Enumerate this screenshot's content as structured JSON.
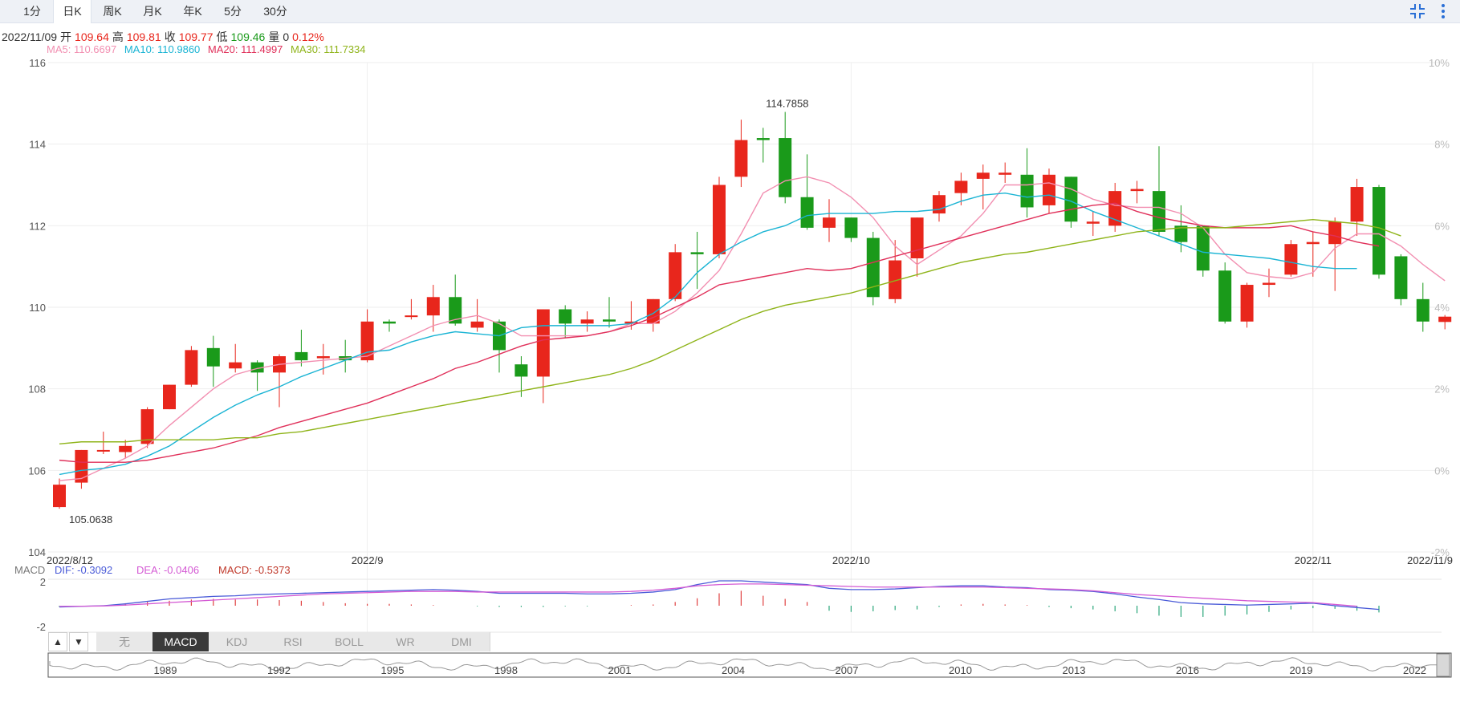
{
  "tabs": [
    {
      "label": "1分"
    },
    {
      "label": "日K"
    },
    {
      "label": "周K"
    },
    {
      "label": "月K"
    },
    {
      "label": "年K"
    },
    {
      "label": "5分"
    },
    {
      "label": "30分"
    }
  ],
  "active_tab": 1,
  "info": {
    "date": "2022/11/09",
    "open_label": "开",
    "open": "109.64",
    "high_label": "高",
    "high": "109.81",
    "close_label": "收",
    "close": "109.77",
    "low_label": "低",
    "low": "109.46",
    "vol_label": "量",
    "vol": "0",
    "change": "0.12%"
  },
  "ma": {
    "ma5": "MA5: 110.6697",
    "ma10": "MA10: 110.9860",
    "ma20": "MA20: 111.4997",
    "ma30": "MA30: 111.7334"
  },
  "macd_legend": {
    "title": "MACD",
    "dif": "DIF: -0.3092",
    "dea": "DEA: -0.0406",
    "macd": "MACD: -0.5373"
  },
  "indicator_tabs": [
    "无",
    "MACD",
    "KDJ",
    "RSI",
    "BOLL",
    "WR",
    "DMI"
  ],
  "active_indicator": 1,
  "up_arrow": "▲",
  "down_arrow": "▼",
  "nav_years": [
    "1989",
    "1992",
    "1995",
    "1998",
    "2001",
    "2004",
    "2007",
    "2010",
    "2013",
    "2016",
    "2019",
    "2022"
  ],
  "colors": {
    "up": "#e8261c",
    "down": "#1a9a1a",
    "ma5": "#f28fb1",
    "ma10": "#1ab4d4",
    "ma20": "#e0305a",
    "ma30": "#8fb41a",
    "dif": "#4a5bd8",
    "dea": "#d45ad4"
  },
  "chart_data": {
    "type": "candlestick",
    "title": "",
    "ylim": [
      104,
      116
    ],
    "yticks": [
      "116",
      "114",
      "112",
      "110",
      "108",
      "106",
      "104"
    ],
    "right_ticks": [
      "10%",
      "8%",
      "6%",
      "4%",
      "2%",
      "0%",
      "-2%"
    ],
    "x_labels": [
      {
        "label": "2022/8/12",
        "i": 0
      },
      {
        "label": "2022/9",
        "i": 14
      },
      {
        "label": "2022/10",
        "i": 36
      },
      {
        "label": "2022/11",
        "i": 57
      },
      {
        "label": "2022/11/9",
        "i": 63
      }
    ],
    "max_label": "114.7858",
    "min_label": "105.0638",
    "candles": [
      {
        "o": 105.1,
        "c": 105.65,
        "h": 105.8,
        "l": 105.06
      },
      {
        "o": 105.7,
        "c": 106.5,
        "h": 106.5,
        "l": 105.55
      },
      {
        "o": 106.5,
        "c": 106.5,
        "h": 106.95,
        "l": 106.4
      },
      {
        "o": 106.45,
        "c": 106.6,
        "h": 106.75,
        "l": 106.3
      },
      {
        "o": 106.65,
        "c": 107.5,
        "h": 107.55,
        "l": 106.55
      },
      {
        "o": 107.5,
        "c": 108.1,
        "h": 108.1,
        "l": 107.5
      },
      {
        "o": 108.1,
        "c": 108.95,
        "h": 109.05,
        "l": 108.05
      },
      {
        "o": 109.0,
        "c": 108.55,
        "h": 109.3,
        "l": 108.05
      },
      {
        "o": 108.5,
        "c": 108.65,
        "h": 109.1,
        "l": 108.4
      },
      {
        "o": 108.65,
        "c": 108.4,
        "h": 108.7,
        "l": 107.95
      },
      {
        "o": 108.4,
        "c": 108.8,
        "h": 108.85,
        "l": 107.55
      },
      {
        "o": 108.9,
        "c": 108.7,
        "h": 109.45,
        "l": 108.55
      },
      {
        "o": 108.75,
        "c": 108.8,
        "h": 109.1,
        "l": 108.35
      },
      {
        "o": 108.8,
        "c": 108.7,
        "h": 109.2,
        "l": 108.4
      },
      {
        "o": 108.7,
        "c": 109.65,
        "h": 109.95,
        "l": 108.65
      },
      {
        "o": 109.65,
        "c": 109.6,
        "h": 109.7,
        "l": 109.4
      },
      {
        "o": 109.78,
        "c": 109.8,
        "h": 110.2,
        "l": 109.7
      },
      {
        "o": 109.8,
        "c": 110.25,
        "h": 110.55,
        "l": 109.4
      },
      {
        "o": 110.25,
        "c": 109.6,
        "h": 110.8,
        "l": 109.55
      },
      {
        "o": 109.5,
        "c": 109.65,
        "h": 110.2,
        "l": 109.4
      },
      {
        "o": 109.65,
        "c": 108.95,
        "h": 109.7,
        "l": 108.4
      },
      {
        "o": 108.6,
        "c": 108.3,
        "h": 108.8,
        "l": 107.8
      },
      {
        "o": 108.3,
        "c": 109.95,
        "h": 109.95,
        "l": 107.65
      },
      {
        "o": 109.95,
        "c": 109.6,
        "h": 110.05,
        "l": 109.25
      },
      {
        "o": 109.6,
        "c": 109.7,
        "h": 109.9,
        "l": 109.4
      },
      {
        "o": 109.7,
        "c": 109.65,
        "h": 110.25,
        "l": 109.5
      },
      {
        "o": 109.6,
        "c": 109.65,
        "h": 110.15,
        "l": 109.45
      },
      {
        "o": 109.6,
        "c": 110.2,
        "h": 110.2,
        "l": 109.4
      },
      {
        "o": 110.2,
        "c": 111.35,
        "h": 111.55,
        "l": 110.15
      },
      {
        "o": 111.35,
        "c": 111.3,
        "h": 111.85,
        "l": 110.45
      },
      {
        "o": 111.3,
        "c": 113.0,
        "h": 113.2,
        "l": 111.2
      },
      {
        "o": 113.2,
        "c": 114.1,
        "h": 114.6,
        "l": 112.95
      },
      {
        "o": 114.15,
        "c": 114.1,
        "h": 114.4,
        "l": 113.55
      },
      {
        "o": 114.15,
        "c": 112.7,
        "h": 114.79,
        "l": 112.55
      },
      {
        "o": 112.7,
        "c": 111.95,
        "h": 113.75,
        "l": 111.9
      },
      {
        "o": 111.95,
        "c": 112.2,
        "h": 112.65,
        "l": 111.6
      },
      {
        "o": 112.2,
        "c": 111.7,
        "h": 112.2,
        "l": 111.6
      },
      {
        "o": 111.7,
        "c": 110.25,
        "h": 111.85,
        "l": 110.05
      },
      {
        "o": 110.2,
        "c": 111.15,
        "h": 111.65,
        "l": 110.1
      },
      {
        "o": 111.2,
        "c": 112.2,
        "h": 112.2,
        "l": 110.75
      },
      {
        "o": 112.3,
        "c": 112.75,
        "h": 112.85,
        "l": 112.1
      },
      {
        "o": 112.8,
        "c": 113.1,
        "h": 113.3,
        "l": 112.5
      },
      {
        "o": 113.15,
        "c": 113.3,
        "h": 113.5,
        "l": 112.4
      },
      {
        "o": 113.25,
        "c": 113.3,
        "h": 113.55,
        "l": 113.05
      },
      {
        "o": 113.25,
        "c": 112.45,
        "h": 113.9,
        "l": 112.2
      },
      {
        "o": 112.5,
        "c": 113.25,
        "h": 113.4,
        "l": 112.3
      },
      {
        "o": 113.2,
        "c": 112.1,
        "h": 113.2,
        "l": 111.95
      },
      {
        "o": 112.05,
        "c": 112.1,
        "h": 112.35,
        "l": 111.75
      },
      {
        "o": 112.0,
        "c": 112.85,
        "h": 113.05,
        "l": 111.85
      },
      {
        "o": 112.85,
        "c": 112.9,
        "h": 113.1,
        "l": 112.55
      },
      {
        "o": 112.85,
        "c": 111.85,
        "h": 113.95,
        "l": 111.75
      },
      {
        "o": 112.0,
        "c": 111.6,
        "h": 112.5,
        "l": 111.35
      },
      {
        "o": 112.0,
        "c": 110.9,
        "h": 112.0,
        "l": 110.75
      },
      {
        "o": 110.9,
        "c": 109.65,
        "h": 111.1,
        "l": 109.6
      },
      {
        "o": 109.65,
        "c": 110.55,
        "h": 110.6,
        "l": 109.5
      },
      {
        "o": 110.55,
        "c": 110.6,
        "h": 110.95,
        "l": 110.25
      },
      {
        "o": 110.8,
        "c": 111.55,
        "h": 111.65,
        "l": 110.75
      },
      {
        "o": 111.55,
        "c": 111.6,
        "h": 111.85,
        "l": 110.75
      },
      {
        "o": 111.55,
        "c": 112.1,
        "h": 112.2,
        "l": 110.4
      },
      {
        "o": 112.1,
        "c": 112.95,
        "h": 113.15,
        "l": 111.75
      },
      {
        "o": 112.95,
        "c": 110.8,
        "h": 113.0,
        "l": 110.7
      },
      {
        "o": 111.25,
        "c": 110.2,
        "h": 111.3,
        "l": 110.05
      },
      {
        "o": 110.2,
        "c": 109.65,
        "h": 110.6,
        "l": 109.4
      },
      {
        "o": 109.64,
        "c": 109.77,
        "h": 109.81,
        "l": 109.46
      }
    ],
    "ma5": [
      105.75,
      105.8,
      106.05,
      106.3,
      106.6,
      107.1,
      107.55,
      108.0,
      108.35,
      108.5,
      108.6,
      108.65,
      108.7,
      108.75,
      108.8,
      109.05,
      109.3,
      109.55,
      109.7,
      109.8,
      109.6,
      109.3,
      109.3,
      109.3,
      109.3,
      109.4,
      109.6,
      109.6,
      109.9,
      110.35,
      110.9,
      111.8,
      112.8,
      113.1,
      113.2,
      113.05,
      112.7,
      112.2,
      111.5,
      111.05,
      111.4,
      111.75,
      112.3,
      113.0,
      113.0,
      113.05,
      112.9,
      112.65,
      112.5,
      112.45,
      112.45,
      112.3,
      111.95,
      111.3,
      110.85,
      110.75,
      110.7,
      110.85,
      111.45,
      111.8,
      111.8,
      111.5,
      111.05,
      110.65
    ],
    "ma10": [
      105.9,
      106.0,
      106.05,
      106.15,
      106.35,
      106.6,
      106.95,
      107.3,
      107.6,
      107.85,
      108.05,
      108.3,
      108.5,
      108.7,
      108.9,
      108.95,
      109.15,
      109.3,
      109.4,
      109.35,
      109.3,
      109.5,
      109.55,
      109.55,
      109.55,
      109.55,
      109.6,
      109.85,
      110.25,
      110.85,
      111.3,
      111.6,
      111.85,
      112.0,
      112.25,
      112.3,
      112.3,
      112.3,
      112.35,
      112.35,
      112.4,
      112.6,
      112.75,
      112.8,
      112.7,
      112.75,
      112.6,
      112.35,
      112.15,
      111.95,
      111.75,
      111.55,
      111.35,
      111.3,
      111.25,
      111.2,
      111.1,
      111.0,
      110.95,
      110.95
    ],
    "ma20": [
      106.25,
      106.2,
      106.2,
      106.2,
      106.25,
      106.35,
      106.45,
      106.55,
      106.7,
      106.85,
      107.05,
      107.2,
      107.35,
      107.5,
      107.65,
      107.85,
      108.05,
      108.25,
      108.5,
      108.65,
      108.85,
      109.05,
      109.2,
      109.25,
      109.3,
      109.4,
      109.55,
      109.75,
      110.0,
      110.25,
      110.55,
      110.65,
      110.75,
      110.85,
      110.95,
      110.9,
      110.95,
      111.1,
      111.25,
      111.4,
      111.55,
      111.7,
      111.85,
      112.0,
      112.15,
      112.3,
      112.4,
      112.5,
      112.55,
      112.35,
      112.2,
      112.1,
      112.0,
      111.95,
      111.95,
      111.95,
      112.0,
      111.85,
      111.75,
      111.6,
      111.5
    ],
    "ma30": [
      106.65,
      106.7,
      106.7,
      106.7,
      106.75,
      106.75,
      106.75,
      106.75,
      106.8,
      106.8,
      106.9,
      106.95,
      107.05,
      107.15,
      107.25,
      107.35,
      107.45,
      107.55,
      107.65,
      107.75,
      107.85,
      107.95,
      108.05,
      108.15,
      108.25,
      108.35,
      108.5,
      108.7,
      108.95,
      109.2,
      109.45,
      109.7,
      109.9,
      110.05,
      110.15,
      110.25,
      110.35,
      110.5,
      110.65,
      110.8,
      110.95,
      111.1,
      111.2,
      111.3,
      111.35,
      111.45,
      111.55,
      111.65,
      111.75,
      111.85,
      111.9,
      111.95,
      111.95,
      111.95,
      112.0,
      112.05,
      112.1,
      112.15,
      112.1,
      112.05,
      111.95,
      111.75
    ],
    "macd": {
      "ylim": [
        -2,
        2
      ],
      "yticks": [
        "2",
        "-2"
      ],
      "dif": [
        -0.1,
        -0.05,
        0.0,
        0.15,
        0.35,
        0.55,
        0.65,
        0.75,
        0.8,
        0.9,
        0.95,
        1.0,
        1.05,
        1.1,
        1.15,
        1.2,
        1.25,
        1.3,
        1.25,
        1.15,
        1.0,
        1.0,
        1.0,
        1.0,
        0.95,
        0.95,
        1.0,
        1.1,
        1.3,
        1.7,
        2.0,
        2.0,
        1.9,
        1.8,
        1.7,
        1.4,
        1.3,
        1.3,
        1.35,
        1.45,
        1.55,
        1.6,
        1.6,
        1.5,
        1.45,
        1.3,
        1.25,
        1.15,
        0.95,
        0.7,
        0.5,
        0.25,
        0.15,
        0.1,
        0.05,
        0.1,
        0.15,
        0.2,
        0.0,
        -0.15,
        -0.3
      ],
      "dea": [
        -0.05,
        -0.04,
        -0.02,
        0.05,
        0.15,
        0.25,
        0.35,
        0.45,
        0.55,
        0.65,
        0.75,
        0.85,
        0.95,
        1.0,
        1.05,
        1.1,
        1.15,
        1.15,
        1.15,
        1.1,
        1.1,
        1.1,
        1.1,
        1.1,
        1.1,
        1.1,
        1.15,
        1.25,
        1.4,
        1.6,
        1.7,
        1.75,
        1.75,
        1.7,
        1.65,
        1.6,
        1.55,
        1.5,
        1.5,
        1.5,
        1.5,
        1.5,
        1.5,
        1.45,
        1.4,
        1.35,
        1.3,
        1.2,
        1.05,
        0.9,
        0.8,
        0.7,
        0.6,
        0.5,
        0.4,
        0.35,
        0.3,
        0.25,
        0.1,
        -0.04
      ],
      "hist": [
        -0.1,
        -0.05,
        0.0,
        0.2,
        0.3,
        0.4,
        0.5,
        0.55,
        0.5,
        0.5,
        0.45,
        0.4,
        0.3,
        0.2,
        0.15,
        0.15,
        0.1,
        0.05,
        0.0,
        -0.05,
        -0.1,
        -0.1,
        -0.1,
        -0.05,
        -0.05,
        0.0,
        0.05,
        0.1,
        0.3,
        0.6,
        1.0,
        1.2,
        0.8,
        0.55,
        0.3,
        -0.4,
        -0.5,
        -0.45,
        -0.35,
        -0.3,
        -0.1,
        0.1,
        0.15,
        0.1,
        0.05,
        -0.1,
        -0.2,
        -0.3,
        -0.45,
        -0.6,
        -0.8,
        -0.9,
        -0.9,
        -0.8,
        -0.7,
        -0.5,
        -0.3,
        -0.2,
        -0.25,
        -0.4,
        -0.54
      ]
    }
  }
}
